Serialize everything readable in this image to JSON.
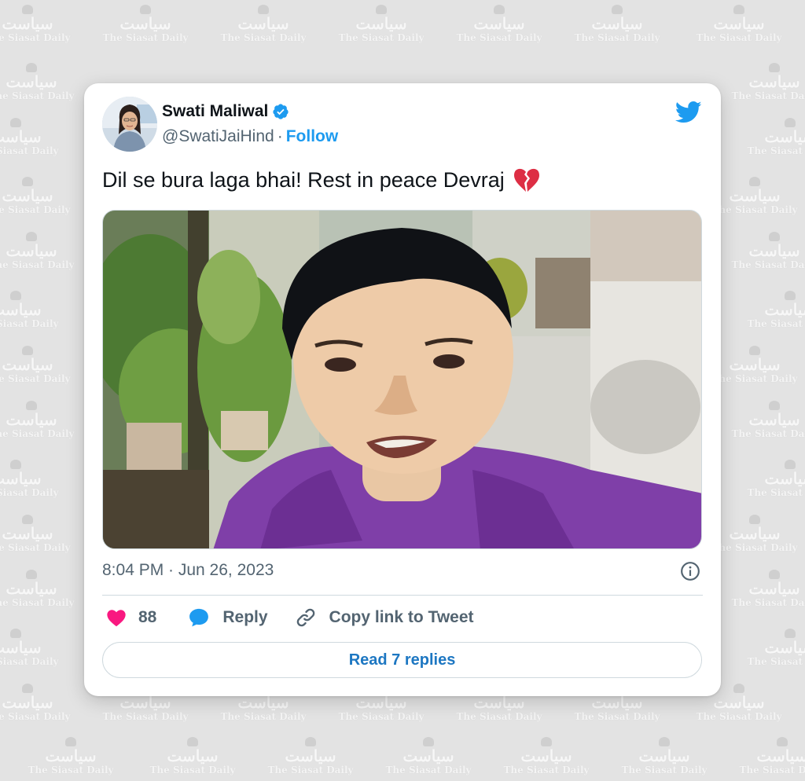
{
  "watermark": {
    "urdu": "سیاست",
    "english": "The Siasat Daily"
  },
  "tweet": {
    "author_name": "Swati Maliwal",
    "handle": "@SwatiJaiHind",
    "separator": "·",
    "follow_label": "Follow",
    "text": "Dil se bura laga bhai! Rest in peace Devraj",
    "emoji": "broken-heart-emoji",
    "timestamp": "8:04 PM · Jun 26, 2023",
    "likes": "88",
    "reply_label": "Reply",
    "copy_link_label": "Copy link to Tweet",
    "read_replies_label": "Read 7 replies"
  },
  "icons": {
    "verified": "verified-badge-icon",
    "brand": "twitter-bird-icon",
    "info": "info-icon",
    "like": "heart-icon",
    "reply": "reply-bubble-icon",
    "copy": "link-icon"
  },
  "colors": {
    "twitter_blue": "#1d9bf0",
    "like_pink": "#f91880",
    "text_primary": "#0f1419",
    "text_secondary": "#536471",
    "shirt_purple": "#8a3fbe"
  }
}
